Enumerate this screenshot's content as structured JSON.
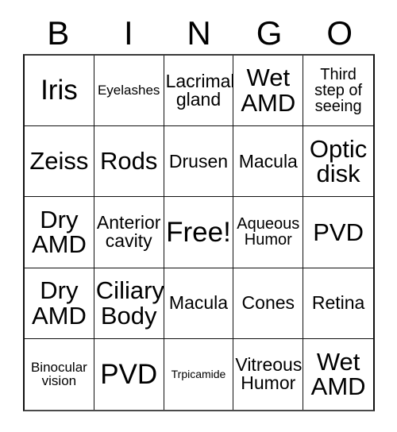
{
  "card": {
    "title": "BINGO",
    "header_letters": [
      "B",
      "I",
      "N",
      "G",
      "O"
    ],
    "free_space_label": "Free!",
    "grid_size": "5x5",
    "colors": {
      "background": "#ffffff",
      "text": "#000000",
      "grid_line": "#111111"
    },
    "rows": [
      [
        {
          "text": "Iris",
          "size": "xxl"
        },
        {
          "text": "Eyelashes",
          "size": "xs"
        },
        {
          "text": "Lacrimal\ngland",
          "size": "md"
        },
        {
          "text": "Wet\nAMD",
          "size": "xl"
        },
        {
          "text": "Third\nstep of\nseeing",
          "size": "sm"
        }
      ],
      [
        {
          "text": "Zeiss",
          "size": "xl"
        },
        {
          "text": "Rods",
          "size": "xl"
        },
        {
          "text": "Drusen",
          "size": "md"
        },
        {
          "text": "Macula",
          "size": "md"
        },
        {
          "text": "Optic\ndisk",
          "size": "xl"
        }
      ],
      [
        {
          "text": "Dry\nAMD",
          "size": "xl"
        },
        {
          "text": "Anterior\ncavity",
          "size": "md"
        },
        {
          "text": "Free!",
          "size": "xxl"
        },
        {
          "text": "Aqueous\nHumor",
          "size": "sm"
        },
        {
          "text": "PVD",
          "size": "xl"
        }
      ],
      [
        {
          "text": "Dry\nAMD",
          "size": "xl"
        },
        {
          "text": "Ciliary\nBody",
          "size": "xl"
        },
        {
          "text": "Macula",
          "size": "md"
        },
        {
          "text": "Cones",
          "size": "md"
        },
        {
          "text": "Retina",
          "size": "md"
        }
      ],
      [
        {
          "text": "Binocular\nvision",
          "size": "xs"
        },
        {
          "text": "PVD",
          "size": "xxl"
        },
        {
          "text": "Trpicamide",
          "size": "xxs"
        },
        {
          "text": "Vitreous\nHumor",
          "size": "md"
        },
        {
          "text": "Wet\nAMD",
          "size": "xl"
        }
      ]
    ]
  }
}
